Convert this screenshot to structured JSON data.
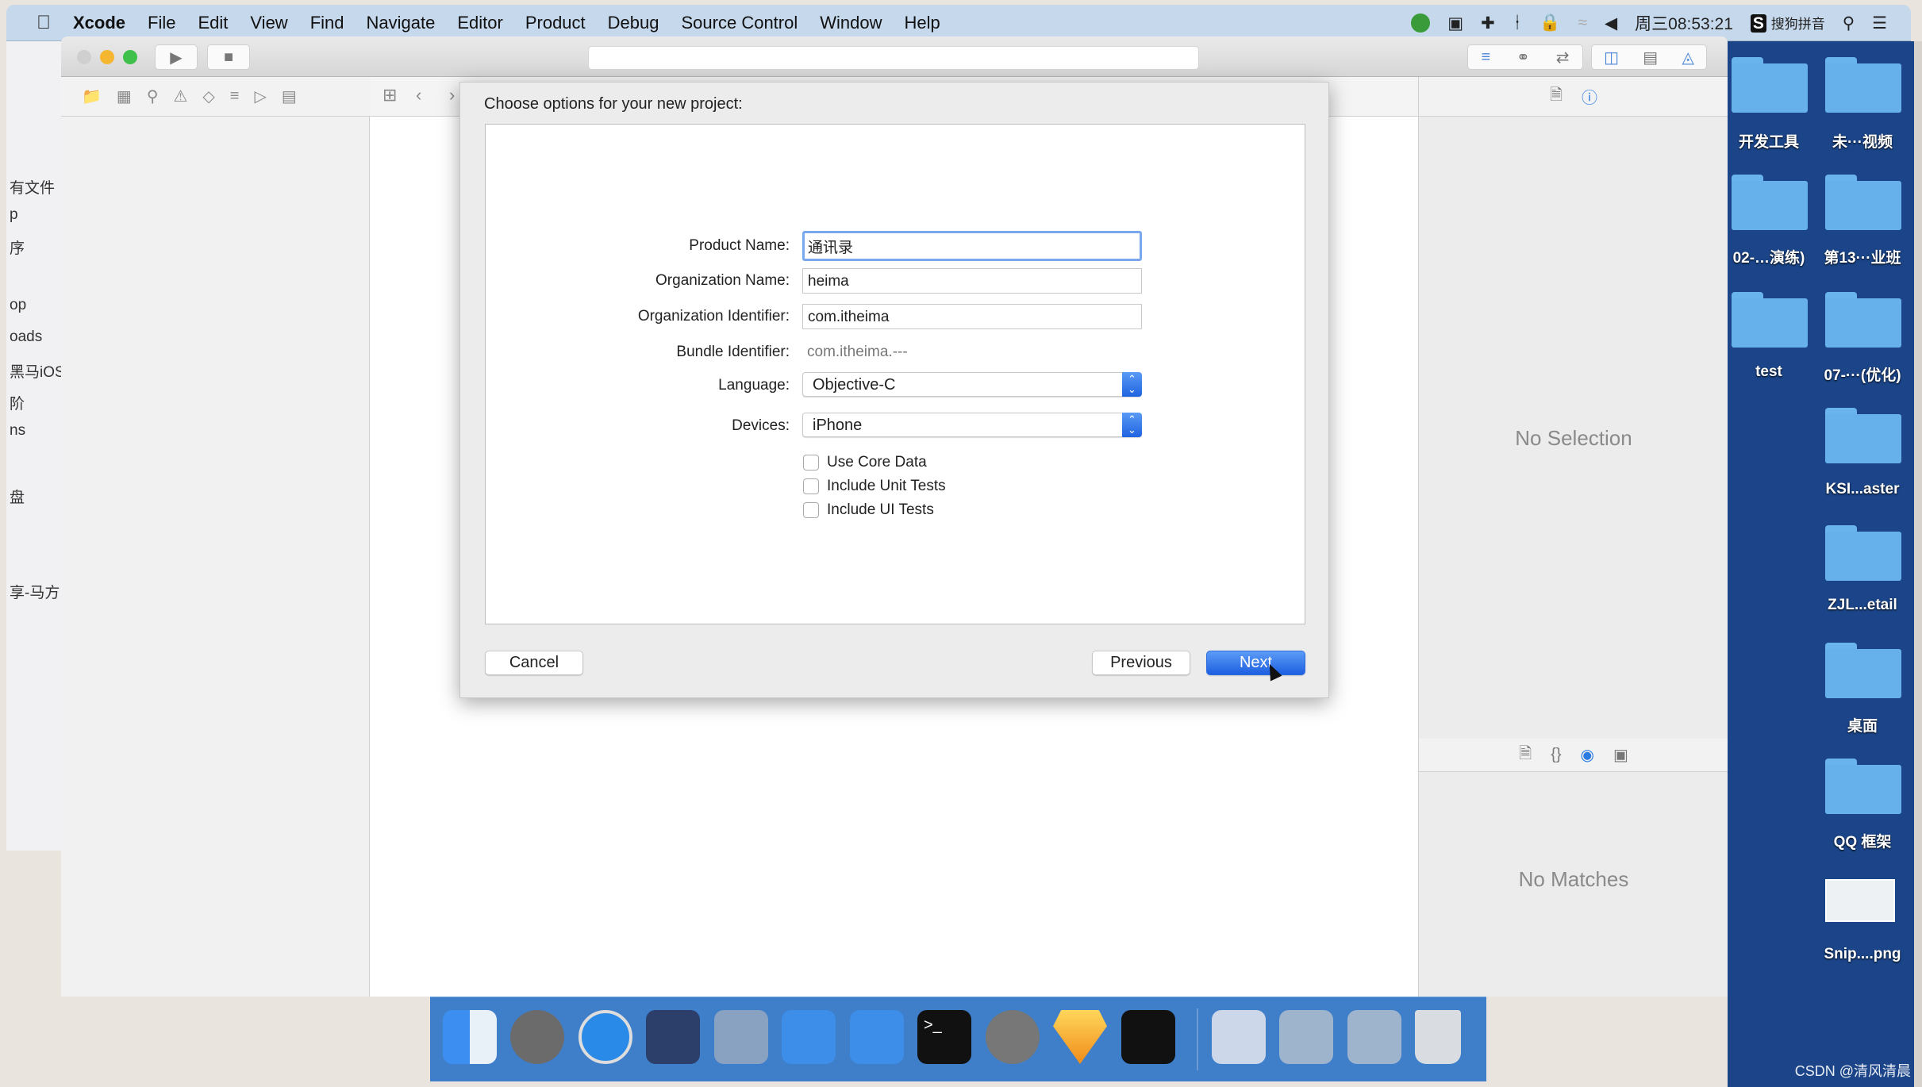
{
  "menubar": {
    "app": "Xcode",
    "items": [
      "File",
      "Edit",
      "View",
      "Find",
      "Navigate",
      "Editor",
      "Product",
      "Debug",
      "Source Control",
      "Window",
      "Help"
    ],
    "clock": "周三08:53:21",
    "input_method": "搜狗拼音"
  },
  "left_window": {
    "items": [
      "有文件",
      "p",
      "序",
      "op",
      "oads",
      "黑马iOS",
      "阶",
      "ns",
      "盘",
      "享-马方"
    ]
  },
  "desktop": {
    "folders": [
      "开发工具",
      "未···视频",
      "02-…演练)",
      "第13···业班",
      "test",
      "07-···(优化)",
      "KSI...aster",
      "ZJL...etail",
      "桌面",
      "QQ 框架",
      "Snip....png"
    ]
  },
  "dialog": {
    "title": "Choose options for your new project:",
    "fields": {
      "product_name": {
        "label": "Product Name:",
        "value": "通讯录"
      },
      "organization_name": {
        "label": "Organization Name:",
        "value": "heima"
      },
      "organization_identifier": {
        "label": "Organization Identifier:",
        "value": "com.itheima"
      },
      "bundle_identifier": {
        "label": "Bundle Identifier:",
        "value": "com.itheima.---"
      },
      "language": {
        "label": "Language:",
        "value": "Objective-C"
      },
      "devices": {
        "label": "Devices:",
        "value": "iPhone"
      }
    },
    "checkboxes": [
      {
        "label": "Use Core Data",
        "checked": false
      },
      {
        "label": "Include Unit Tests",
        "checked": false
      },
      {
        "label": "Include UI Tests",
        "checked": false
      }
    ],
    "buttons": {
      "cancel": "Cancel",
      "previous": "Previous",
      "next": "Next"
    }
  },
  "inspector": {
    "no_selection": "No Selection",
    "no_matches": "No Matches"
  },
  "watermark": "CSDN @清风清晨",
  "colors": {
    "accent": "#2a6fe6",
    "menubar": "#c6d8ec",
    "desktop": "#1b4588",
    "dock": "#3f7ec9"
  }
}
